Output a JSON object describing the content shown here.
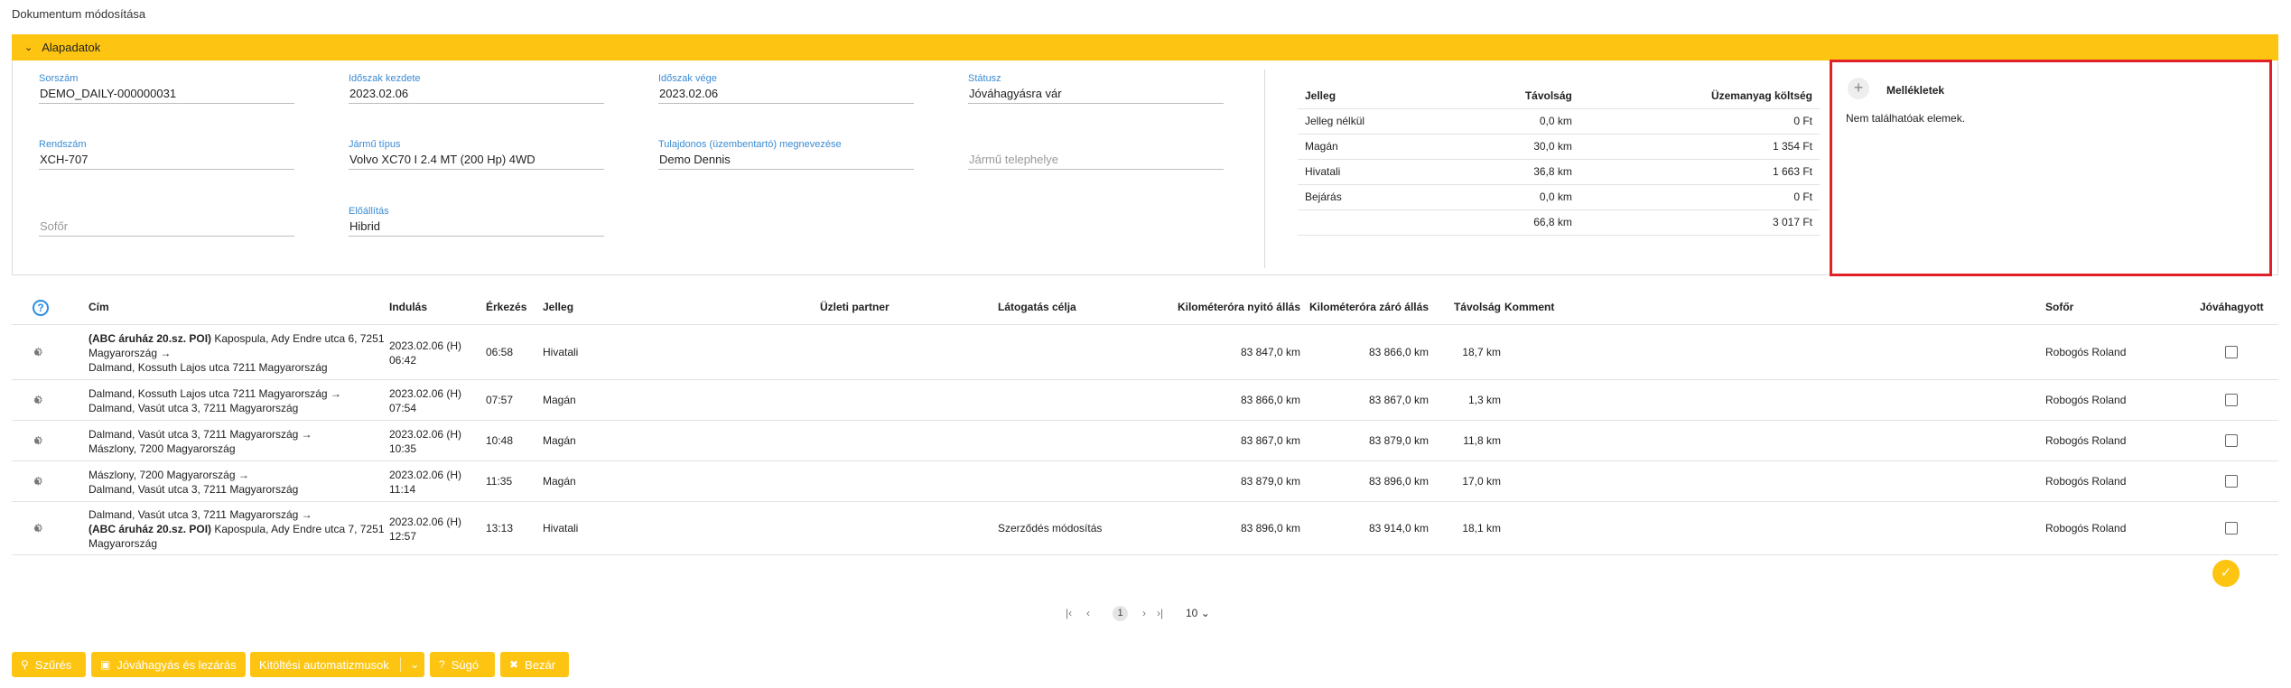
{
  "page": {
    "title": "Dokumentum módosítása"
  },
  "section": {
    "title": "Alapadatok"
  },
  "fields": {
    "sorszam": {
      "label": "Sorszám",
      "value": "DEMO_DAILY-000000031"
    },
    "idoszak_kezdete": {
      "label": "Időszak kezdete",
      "value": "2023.02.06"
    },
    "idoszak_vege": {
      "label": "Időszak vége",
      "value": "2023.02.06"
    },
    "statusz": {
      "label": "Státusz",
      "value": "Jóváhagyásra vár"
    },
    "rendszam": {
      "label": "Rendszám",
      "value": "XCH-707"
    },
    "jarmu_tipus": {
      "label": "Jármű típus",
      "value": "Volvo XC70 I 2.4 MT (200 Hp) 4WD"
    },
    "tulajdonos": {
      "label": "Tulajdonos (üzembentartó) megnevezése",
      "value": "Demo Dennis"
    },
    "jarmu_telephelye": {
      "placeholder": "Jármű telephelye"
    },
    "sofor": {
      "placeholder": "Sofőr"
    },
    "elofeltetel": {
      "label": "Előállítás",
      "value": "Hibrid"
    }
  },
  "summary": {
    "headers": [
      "Jelleg",
      "Távolság",
      "Üzemanyag költség"
    ],
    "rows": [
      [
        "Jelleg nélkül",
        "0,0 km",
        "0 Ft"
      ],
      [
        "Magán",
        "30,0 km",
        "1 354 Ft"
      ],
      [
        "Hivatali",
        "36,8 km",
        "1 663 Ft"
      ],
      [
        "Bejárás",
        "0,0 km",
        "0 Ft"
      ],
      [
        "",
        "66,8 km",
        "3 017 Ft"
      ]
    ]
  },
  "attachments": {
    "title": "Mellékletek",
    "empty": "Nem találhatóak elemek."
  },
  "trips": {
    "headers": {
      "help": "?",
      "cim": "Cím",
      "indulas": "Indulás",
      "erkezes": "Érkezés",
      "jelleg": "Jelleg",
      "uzleti_partner": "Üzleti partner",
      "latogatas_celja": "Látogatás célja",
      "km_nyito": "Kilométeróra nyitó állás",
      "km_zaro": "Kilométeróra záró állás",
      "tavolsag": "Távolság",
      "komment": "Komment",
      "sofor": "Sofőr",
      "jovahagyott": "Jóváhagyott"
    },
    "rows": [
      {
        "addr_bold": "(ABC áruház 20.sz. POI)",
        "addr_l1": " Kapospula, Ady Endre utca 6, 7251",
        "addr_l2": "Magyarország →",
        "addr_l3": "Dalmand, Kossuth Lajos utca 7211 Magyarország",
        "indulas_l1": "2023.02.06 (H)",
        "indulas_l2": "06:42",
        "erkezes": "06:58",
        "jelleg": "Hivatali",
        "latogatas": "",
        "km_nyito": "83 847,0 km",
        "km_zaro": "83 866,0 km",
        "tavolsag": "18,7 km",
        "sofor": "Robogós Roland"
      },
      {
        "addr_l1": "Dalmand, Kossuth Lajos utca 7211 Magyarország →",
        "addr_l2": "Dalmand, Vasút utca 3, 7211 Magyarország",
        "indulas_l1": "2023.02.06 (H)",
        "indulas_l2": "07:54",
        "erkezes": "07:57",
        "jelleg": "Magán",
        "latogatas": "",
        "km_nyito": "83 866,0 km",
        "km_zaro": "83 867,0 km",
        "tavolsag": "1,3 km",
        "sofor": "Robogós Roland"
      },
      {
        "addr_l1": "Dalmand, Vasút utca 3, 7211 Magyarország →",
        "addr_l2": "Mászlony, 7200 Magyarország",
        "indulas_l1": "2023.02.06 (H)",
        "indulas_l2": "10:35",
        "erkezes": "10:48",
        "jelleg": "Magán",
        "latogatas": "",
        "km_nyito": "83 867,0 km",
        "km_zaro": "83 879,0 km",
        "tavolsag": "11,8 km",
        "sofor": "Robogós Roland"
      },
      {
        "addr_l1": "Mászlony, 7200 Magyarország →",
        "addr_l2": "Dalmand, Vasút utca 3, 7211 Magyarország",
        "indulas_l1": "2023.02.06 (H)",
        "indulas_l2": "11:14",
        "erkezes": "11:35",
        "jelleg": "Magán",
        "latogatas": "",
        "km_nyito": "83 879,0 km",
        "km_zaro": "83 896,0 km",
        "tavolsag": "17,0 km",
        "sofor": "Robogós Roland"
      },
      {
        "addr_l1": "Dalmand, Vasút utca 3, 7211 Magyarország →",
        "addr_bold": "(ABC áruház 20.sz. POI)",
        "addr_l2": " Kapospula, Ady Endre utca 7, 7251",
        "addr_l3": "Magyarország",
        "indulas_l1": "2023.02.06 (H)",
        "indulas_l2": "12:57",
        "erkezes": "13:13",
        "jelleg": "Hivatali",
        "latogatas": "Szerződés módosítás",
        "km_nyito": "83 896,0 km",
        "km_zaro": "83 914,0 km",
        "tavolsag": "18,1 km",
        "sofor": "Robogós Roland"
      }
    ]
  },
  "pager": {
    "current": "1",
    "page_size": "10"
  },
  "buttons": {
    "filter": "Szűrés",
    "approve_close": "Jóváhagyás és lezárás",
    "autofill": "Kitöltési automatizmusok",
    "help": "Súgó",
    "close": "Bezár"
  },
  "icons": {
    "chevron": "chevron-down-icon",
    "plus": "plus-icon",
    "help": "help-circle-icon",
    "location": "location-pin-icon",
    "settings": "gear-icon",
    "check": "double-check-icon",
    "search": "search-icon",
    "save": "save-icon",
    "close": "close-circle-icon"
  },
  "colors": {
    "accent": "#fdc511",
    "link": "#3a8bd4",
    "highlight_border": "#e02128"
  }
}
